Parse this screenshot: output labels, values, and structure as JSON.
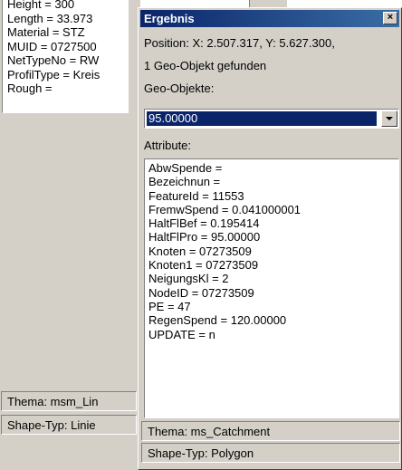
{
  "back_window": {
    "attributes": [
      "Height = 300",
      "Length = 33.973",
      "Material = STZ",
      "MUID = 0727500",
      "NetTypeNo = RW",
      "ProfilType = Kreis",
      "Rough ="
    ],
    "thema": "Thema:  msm_Lin",
    "shape_typ": "Shape-Typ: Linie"
  },
  "dialog": {
    "title": "Ergebnis",
    "close_label": "×",
    "position": "Position: X: 2.507.317,  Y: 5.627.300,",
    "found": "1 Geo-Objekt gefunden",
    "geo_objects_label": "Geo-Objekte:",
    "geo_object_selected": "95.00000",
    "attributes_label": "Attribute:",
    "attributes": [
      "AbwSpende =",
      "Bezeichnun =",
      "FeatureId = 11553",
      "FremwSpend = 0.041000001",
      "HaltFlBef = 0.195414",
      "HaltFlPro = 95.00000",
      "Knoten = 07273509",
      "Knoten1 = 07273509",
      "NeigungsKl = 2",
      "NodeID = 07273509",
      "PE = 47",
      "RegenSpend = 120.00000",
      "UPDATE = n"
    ],
    "thema": "Thema:  ms_Catchment",
    "shape_typ": "Shape-Typ: Polygon"
  }
}
